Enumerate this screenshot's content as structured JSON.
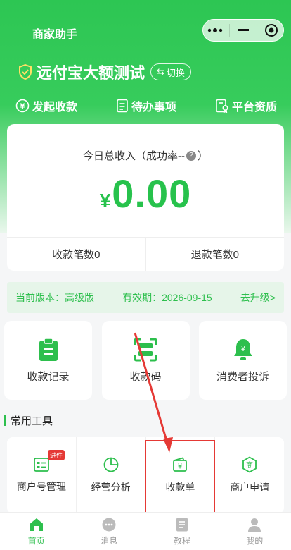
{
  "app": {
    "title": "商家助手"
  },
  "merchant": {
    "name": "远付宝大额测试",
    "switch_label": "切换"
  },
  "quick_actions": [
    {
      "label": "发起收款",
      "icon": "yen-circle-icon"
    },
    {
      "label": "待办事项",
      "icon": "document-list-icon"
    },
    {
      "label": "平台资质",
      "icon": "certificate-icon"
    }
  ],
  "income": {
    "label_prefix": "今日总收入（成功率--",
    "label_suffix": "）",
    "currency": "¥",
    "amount": "0.00",
    "receipt_count": "收款笔数0",
    "refund_count": "退款笔数0"
  },
  "version": {
    "current": "当前版本：高级版",
    "expiry": "有效期：2026-09-15",
    "upgrade": "去升级>"
  },
  "big_tiles": [
    {
      "label": "收款记录",
      "icon": "clipboard-icon"
    },
    {
      "label": "收款码",
      "icon": "qr-scan-icon"
    },
    {
      "label": "消费者投诉",
      "icon": "bell-yen-icon"
    }
  ],
  "tools": {
    "title": "常用工具",
    "items": [
      {
        "label": "商户号管理",
        "icon": "id-card-icon",
        "badge": "进件"
      },
      {
        "label": "经营分析",
        "icon": "pie-chart-icon"
      },
      {
        "label": "收款单",
        "icon": "wallet-yen-icon"
      },
      {
        "label": "商户申请",
        "icon": "merchant-seal-icon"
      }
    ]
  },
  "tabbar": [
    {
      "label": "首页",
      "icon": "home-icon",
      "active": true
    },
    {
      "label": "消息",
      "icon": "chat-icon"
    },
    {
      "label": "教程",
      "icon": "book-icon"
    },
    {
      "label": "我的",
      "icon": "user-icon"
    }
  ],
  "colors": {
    "brand_green": "#2dbf4d",
    "accent_red": "#e53935"
  }
}
